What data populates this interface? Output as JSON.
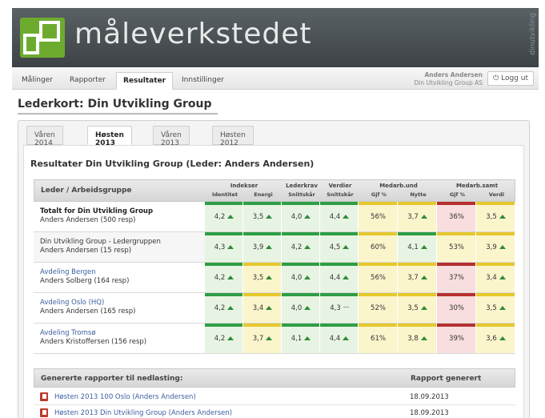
{
  "app": {
    "brand": "måleverkstedet",
    "side_brand": "dinutvikling"
  },
  "nav": {
    "tabs": [
      "Målinger",
      "Rapporter",
      "Resultater",
      "Innstillinger"
    ],
    "active_tab": "Resultater",
    "user_name": "Anders Andersen",
    "user_org": "Din Utvikling Group AS",
    "logout_label": "Logg ut"
  },
  "page": {
    "title": "Lederkort: Din Utvikling Group"
  },
  "seasons": {
    "tabs": [
      "Våren 2014",
      "Høsten 2013",
      "Våren 2013",
      "Høsten 2012"
    ],
    "active": "Høsten 2013"
  },
  "results": {
    "title": "Resultater Din Utvikling Group (Leder: Anders Andersen)",
    "header_main": "Leder / Arbeidsgruppe",
    "groups": [
      "Indekser",
      "Lederkrav",
      "Verdier",
      "Medarb.und",
      "Medarb.samt"
    ],
    "subheaders": [
      "Identitet",
      "Energi",
      "Snittskår",
      "Snittskår",
      "Gjf %",
      "Nytte",
      "Gjf %",
      "Verdi"
    ],
    "rows": [
      {
        "line1": "Totalt for Din Utvikling Group",
        "line2": "Anders Andersen (500 resp)",
        "style": "bold",
        "values": [
          "4,2",
          "3,5",
          "4,0",
          "4,4",
          "56%",
          "3,7",
          "36%",
          "3,5"
        ],
        "arrows": [
          "up",
          "up",
          "up",
          "up",
          "",
          "up",
          "",
          "up"
        ]
      },
      {
        "line1": "Din Utvikling Group - Ledergruppen",
        "line2": "Anders Andersen (15 resp)",
        "style": "plain",
        "values": [
          "4,3",
          "3,9",
          "4,2",
          "4,5",
          "60%",
          "4,1",
          "53%",
          "3,9"
        ],
        "arrows": [
          "up",
          "up",
          "up",
          "up",
          "",
          "up",
          "",
          "up"
        ]
      },
      {
        "line1": "Avdeling Bergen",
        "line2": "Anders Solberg (164 resp)",
        "style": "link",
        "values": [
          "4,2",
          "3,5",
          "4,0",
          "4,4",
          "56%",
          "3,7",
          "37%",
          "3,4"
        ],
        "arrows": [
          "up",
          "up",
          "up",
          "up",
          "",
          "up",
          "",
          "up"
        ]
      },
      {
        "line1": "Avdeling Oslo (HQ)",
        "line2": "Anders Andersen (165 resp)",
        "style": "link",
        "values": [
          "4,2",
          "3,4",
          "4,0",
          "4,3",
          "52%",
          "3,5",
          "30%",
          "3,5"
        ],
        "arrows": [
          "up",
          "up",
          "up",
          "dash",
          "",
          "up",
          "",
          "up"
        ]
      },
      {
        "line1": "Avdeling Tromsø",
        "line2": "Anders Kristoffersen (156 resp)",
        "style": "link",
        "values": [
          "4,2",
          "3,7",
          "4,1",
          "4,4",
          "61%",
          "3,8",
          "39%",
          "3,6"
        ],
        "arrows": [
          "up",
          "up",
          "up",
          "up",
          "",
          "up",
          "",
          "up"
        ]
      }
    ]
  },
  "downloads": {
    "header_left": "Genererte rapporter til nedlasting:",
    "header_right": "Rapport generert",
    "items": [
      {
        "label": "Høsten 2013 100 Oslo (Anders Andersen)",
        "date": "18.09.2013"
      },
      {
        "label": "Høsten 2013 Din Utvikling Group (Anders Andersen)",
        "date": "18.09.2013"
      }
    ]
  },
  "colors": {
    "green_bar": "#2e9e45",
    "green_bg": "#e8f4e3",
    "yellow_bar": "#e5c82c",
    "yellow_bg": "#fbf5cc",
    "red_bar": "#b53030",
    "red_bg": "#f8dede"
  }
}
